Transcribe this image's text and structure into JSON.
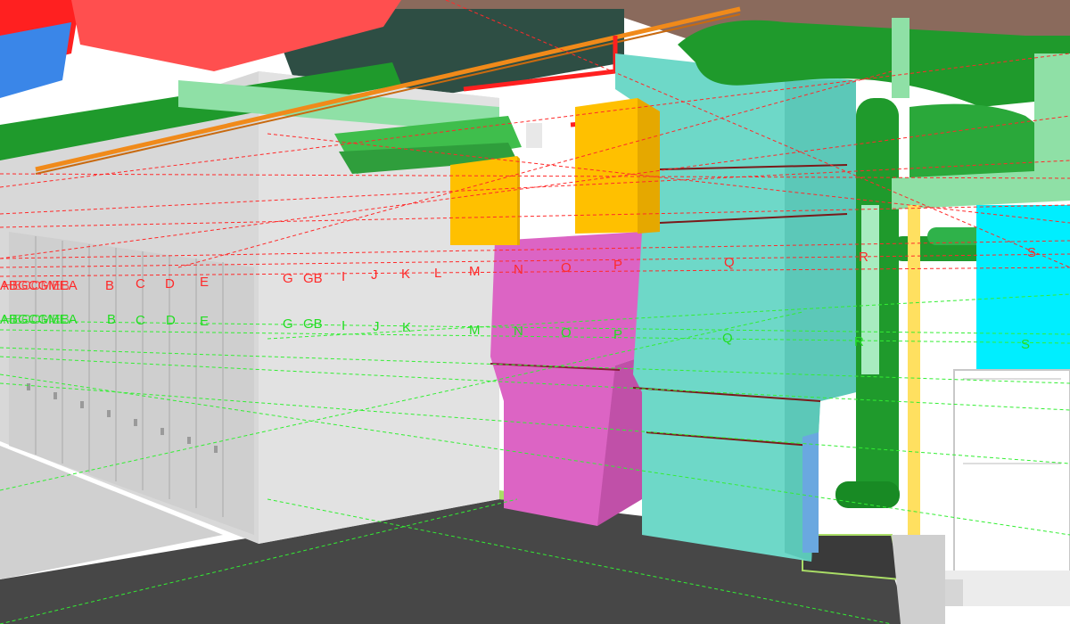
{
  "viewport": {
    "name": "3d-model-view",
    "background": "#ffffff"
  },
  "colors": {
    "upper_gridline": "#ff2a2a",
    "lower_gridline": "#33ee33",
    "floor": "#474747",
    "wall_gray": "#d8d8d8",
    "pink_duct": "#dc64c4",
    "teal_duct": "#6ed8c8",
    "yellow_box": "#ffc000",
    "green_pipe": "#1f9a2c",
    "light_green_pipe": "#8fe0a6",
    "cyan_panel": "#00eeff",
    "red_duct": "#ff4040",
    "blue_duct": "#3a86e8",
    "orange_pipe": "#f08a1a",
    "ceiling_brown": "#8a6a5c"
  },
  "upper_grid_labels": [
    {
      "text": "B",
      "color": "#ff2a2a"
    },
    {
      "text": "C",
      "color": "#ff2a2a"
    },
    {
      "text": "D",
      "color": "#ff2a2a"
    },
    {
      "text": "E",
      "color": "#ff2a2a"
    },
    {
      "text": "G",
      "color": "#ff2a2a"
    },
    {
      "text": "GB",
      "color": "#ff2a2a"
    },
    {
      "text": "I",
      "color": "#ff2a2a"
    },
    {
      "text": "J",
      "color": "#ff2a2a"
    },
    {
      "text": "K",
      "color": "#ff2a2a"
    },
    {
      "text": "L",
      "color": "#ff2a2a"
    },
    {
      "text": "M",
      "color": "#ff2a2a"
    },
    {
      "text": "N",
      "color": "#ff2a2a"
    },
    {
      "text": "O",
      "color": "#ff2a2a"
    },
    {
      "text": "P",
      "color": "#ff2a2a"
    },
    {
      "text": "Q",
      "color": "#ff2a2a"
    },
    {
      "text": "R",
      "color": "#ff2a2a"
    },
    {
      "text": "S",
      "color": "#ff2a2a"
    }
  ],
  "lower_grid_labels": [
    {
      "text": "B",
      "color": "#22dd22"
    },
    {
      "text": "C",
      "color": "#22dd22"
    },
    {
      "text": "D",
      "color": "#22dd22"
    },
    {
      "text": "E",
      "color": "#22dd22"
    },
    {
      "text": "G",
      "color": "#22dd22"
    },
    {
      "text": "GB",
      "color": "#22dd22"
    },
    {
      "text": "I",
      "color": "#22dd22"
    },
    {
      "text": "J",
      "color": "#22dd22"
    },
    {
      "text": "K",
      "color": "#22dd22"
    },
    {
      "text": "M",
      "color": "#22dd22"
    },
    {
      "text": "N",
      "color": "#22dd22"
    },
    {
      "text": "O",
      "color": "#22dd22"
    },
    {
      "text": "P",
      "color": "#22dd22"
    },
    {
      "text": "Q",
      "color": "#22dd22"
    },
    {
      "text": "R",
      "color": "#22dd22"
    },
    {
      "text": "S",
      "color": "#22dd22"
    }
  ]
}
